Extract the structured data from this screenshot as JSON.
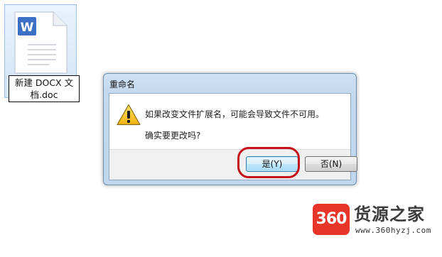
{
  "desktop": {
    "file_name_line1": "新建 DOCX 文",
    "file_name_line2": "档.doc",
    "file_icon": "wps-writer-document-icon",
    "file_icon_letter": "W"
  },
  "dialog": {
    "title": "重命名",
    "icon": "warning-icon",
    "message": "如果改变文件扩展名，可能会导致文件不可用。",
    "question": "确实要更改吗?",
    "yes_label": "是(Y)",
    "no_label": "否(N)"
  },
  "watermark": {
    "logo_text": "360",
    "name": "货源之家",
    "url": "www.360hyzj.com"
  },
  "colors": {
    "highlight": "#c4121a",
    "dialog_frame": "#c4d9ee",
    "icon_blue": "#3d6fc4",
    "warning_yellow": "#f2c21b",
    "watermark_red": "#e8352a"
  }
}
